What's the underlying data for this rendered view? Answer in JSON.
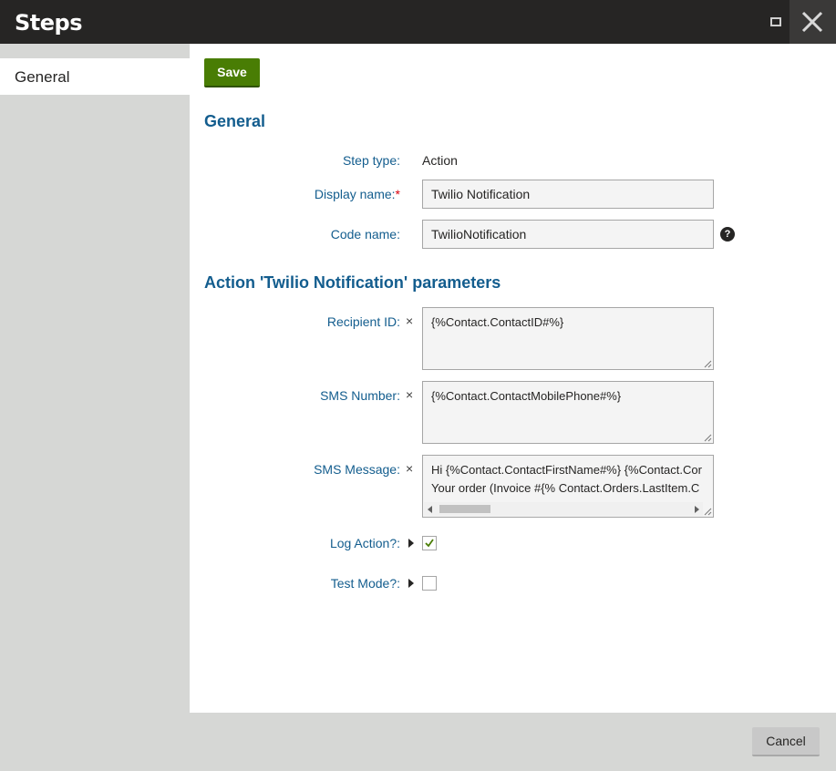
{
  "window": {
    "title": "Steps"
  },
  "sidebar": {
    "items": [
      {
        "label": "General"
      }
    ]
  },
  "toolbar": {
    "save_label": "Save"
  },
  "general": {
    "heading": "General",
    "step_type_label": "Step type:",
    "step_type_value": "Action",
    "display_name_label": "Display name:",
    "display_name_required": "*",
    "display_name_value": "Twilio Notification",
    "code_name_label": "Code name:",
    "code_name_value": "TwilioNotification",
    "help_glyph": "?"
  },
  "parameters": {
    "heading": "Action 'Twilio Notification' parameters",
    "recipient_id_label": "Recipient ID:",
    "recipient_id_value": "{%Contact.ContactID#%}",
    "sms_number_label": "SMS Number:",
    "sms_number_value": "{%Contact.ContactMobilePhone#%}",
    "sms_message_label": "SMS Message:",
    "sms_message_line1": "Hi {%Contact.ContactFirstName#%} {%Contact.Cor",
    "sms_message_line2": "Your order (Invoice #{% Contact.Orders.LastItem.C",
    "log_action_label": "Log Action?:",
    "log_action_checked": true,
    "test_mode_label": "Test Mode?:",
    "test_mode_checked": false,
    "clear_glyph": "×"
  },
  "footer": {
    "cancel_label": "Cancel"
  },
  "colors": {
    "accent": "#135d8e",
    "save_green": "#497d04",
    "titlebar": "#262524",
    "required": "#d8000c"
  },
  "icons": [
    "maximize-icon",
    "close-icon",
    "clear-icon",
    "help-icon",
    "expand-arrow-icon",
    "checkmark-icon"
  ]
}
